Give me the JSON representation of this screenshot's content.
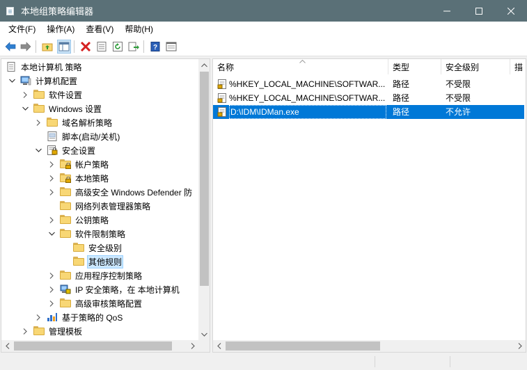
{
  "window": {
    "title": "本地组策略编辑器",
    "controls": [
      "minimize-icon",
      "maximize-icon",
      "close-icon"
    ]
  },
  "menu": [
    "文件(F)",
    "操作(A)",
    "查看(V)",
    "帮助(H)"
  ],
  "toolbar": [
    "back-arrow-icon",
    "forward-arrow-icon",
    "up-folder-icon",
    "show-hide-tree-icon",
    "delete-icon",
    "properties-icon",
    "refresh-icon",
    "export-list-icon",
    "help-icon",
    "view-icon"
  ],
  "tree": [
    {
      "label": "本地计算机 策略",
      "icon": "computer-policy-icon",
      "expand": "none"
    },
    {
      "label": "计算机配置",
      "icon": "computer-icon",
      "expand": "expanded"
    },
    {
      "label": "软件设置",
      "icon": "folder-icon",
      "expand": "collapsed"
    },
    {
      "label": "Windows 设置",
      "icon": "folder-icon",
      "expand": "expanded"
    },
    {
      "label": "域名解析策略",
      "icon": "folder-icon",
      "expand": "collapsed"
    },
    {
      "label": "脚本(启动/关机)",
      "icon": "script-icon",
      "expand": "none"
    },
    {
      "label": "安全设置",
      "icon": "security-settings-icon",
      "expand": "expanded"
    },
    {
      "label": "帐户策略",
      "icon": "locked-folder-icon",
      "expand": "collapsed"
    },
    {
      "label": "本地策略",
      "icon": "locked-folder-icon",
      "expand": "collapsed"
    },
    {
      "label": "高级安全 Windows Defender 防",
      "icon": "folder-icon",
      "expand": "collapsed"
    },
    {
      "label": "网络列表管理器策略",
      "icon": "folder-icon",
      "expand": "none"
    },
    {
      "label": "公钥策略",
      "icon": "folder-icon",
      "expand": "collapsed"
    },
    {
      "label": "软件限制策略",
      "icon": "folder-icon",
      "expand": "expanded"
    },
    {
      "label": "安全级别",
      "icon": "folder-icon",
      "expand": "none"
    },
    {
      "label": "其他规则",
      "icon": "folder-icon",
      "expand": "none",
      "selected": true
    },
    {
      "label": "应用程序控制策略",
      "icon": "folder-icon",
      "expand": "collapsed"
    },
    {
      "label": "IP 安全策略，在 本地计算机",
      "icon": "ip-security-icon",
      "expand": "collapsed"
    },
    {
      "label": "高级审核策略配置",
      "icon": "folder-icon",
      "expand": "collapsed"
    },
    {
      "label": "基于策略的 QoS",
      "icon": "qos-chart-icon",
      "expand": "collapsed"
    },
    {
      "label": "管理模板",
      "icon": "folder-icon",
      "expand": "collapsed"
    }
  ],
  "list": {
    "columns": [
      "名称",
      "类型",
      "安全级别",
      "描"
    ],
    "rows": [
      {
        "name": "%HKEY_LOCAL_MACHINE\\SOFTWAR...",
        "type": "路径",
        "level": "不受限",
        "selected": false
      },
      {
        "name": "%HKEY_LOCAL_MACHINE\\SOFTWAR...",
        "type": "路径",
        "level": "不受限",
        "selected": false
      },
      {
        "name": "D:\\IDM\\IDMan.exe",
        "type": "路径",
        "level": "不允许",
        "selected": true
      }
    ]
  },
  "colors": {
    "titlebar": "#5a7077",
    "selection": "#0078d7",
    "tree_selection": "#cce8ff",
    "folder": "#f8d775"
  }
}
